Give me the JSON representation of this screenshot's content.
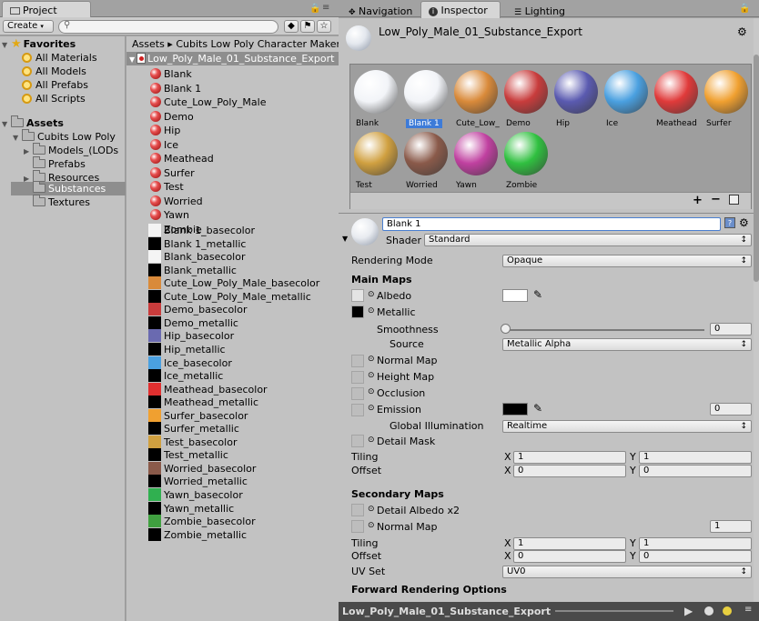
{
  "left_tabs": {
    "project": "Project"
  },
  "right_tabs": {
    "navigation": "Navigation",
    "inspector": "Inspector",
    "lighting": "Lighting"
  },
  "project": {
    "create_label": "Create",
    "breadcrumb": "Assets ▸ Cubits Low Poly Character Maker",
    "favorites": {
      "title": "Favorites",
      "items": [
        "All Materials",
        "All Models",
        "All Prefabs",
        "All Scripts"
      ]
    },
    "assets": {
      "title": "Assets",
      "child": "Cubits Low Poly",
      "subfolders": [
        "Models_(LODs",
        "Prefabs",
        "Resources",
        "Substances",
        "Textures"
      ]
    },
    "substance_name": "Low_Poly_Male_01_Substance_Export",
    "materials": [
      "Blank",
      "Blank 1",
      "Cute_Low_Poly_Male",
      "Demo",
      "Hip",
      "Ice",
      "Meathead",
      "Surfer",
      "Test",
      "Worried",
      "Yawn",
      "Zombie"
    ],
    "textures": [
      {
        "name": "Blank 1_basecolor",
        "color": "#f4f4f4"
      },
      {
        "name": "Blank 1_metallic",
        "color": "#000000"
      },
      {
        "name": "Blank_basecolor",
        "color": "#f4f4f4"
      },
      {
        "name": "Blank_metallic",
        "color": "#000000"
      },
      {
        "name": "Cute_Low_Poly_Male_basecolor",
        "color": "#d98a3a"
      },
      {
        "name": "Cute_Low_Poly_Male_metallic",
        "color": "#000000"
      },
      {
        "name": "Demo_basecolor",
        "color": "#c83c3c"
      },
      {
        "name": "Demo_metallic",
        "color": "#000000"
      },
      {
        "name": "Hip_basecolor",
        "color": "#6a6ab0"
      },
      {
        "name": "Hip_metallic",
        "color": "#000000"
      },
      {
        "name": "Ice_basecolor",
        "color": "#4aa0e0"
      },
      {
        "name": "Ice_metallic",
        "color": "#000000"
      },
      {
        "name": "Meathead_basecolor",
        "color": "#e03030"
      },
      {
        "name": "Meathead_metallic",
        "color": "#000000"
      },
      {
        "name": "Surfer_basecolor",
        "color": "#f0a030"
      },
      {
        "name": "Surfer_metallic",
        "color": "#000000"
      },
      {
        "name": "Test_basecolor",
        "color": "#d0a040"
      },
      {
        "name": "Test_metallic",
        "color": "#000000"
      },
      {
        "name": "Worried_basecolor",
        "color": "#8a5a4a"
      },
      {
        "name": "Worried_metallic",
        "color": "#000000"
      },
      {
        "name": "Yawn_basecolor",
        "color": "#30b050"
      },
      {
        "name": "Yawn_metallic",
        "color": "#000000"
      },
      {
        "name": "Zombie_basecolor",
        "color": "#40a040"
      },
      {
        "name": "Zombie_metallic",
        "color": "#000000"
      }
    ]
  },
  "inspector": {
    "title": "Low_Poly_Male_01_Substance_Export",
    "preview_row1": [
      "Blank",
      "Blank 1",
      "Cute_Low_",
      "Demo",
      "Hip",
      "Ice",
      "Meathead",
      "Surfer"
    ],
    "preview_row2": [
      "Test",
      "Worried",
      "Yawn",
      "Zombie"
    ],
    "preview_colors": [
      "#f2f4f8",
      "#f2f4f8",
      "#d98a3a",
      "#c83c3c",
      "#5a5ab0",
      "#4aa0e0",
      "#e03a3a",
      "#f0a030",
      "#d0a040",
      "#8a5a4a",
      "#c040a0",
      "#30c040"
    ],
    "material_name": "Blank 1",
    "shader_label": "Shader",
    "shader_value": "Standard",
    "rendering_mode_label": "Rendering Mode",
    "rendering_mode_value": "Opaque",
    "main_maps": "Main Maps",
    "albedo": "Albedo",
    "metallic": "Metallic",
    "smoothness": "Smoothness",
    "smoothness_value": "0",
    "source": "Source",
    "source_value": "Metallic Alpha",
    "normal_map": "Normal Map",
    "height_map": "Height Map",
    "occlusion": "Occlusion",
    "emission": "Emission",
    "emission_value": "0",
    "global_illumination": "Global Illumination",
    "gi_value": "Realtime",
    "detail_mask": "Detail Mask",
    "tiling": "Tiling",
    "offset": "Offset",
    "tiling_x": "1",
    "tiling_y": "1",
    "offset_x": "0",
    "offset_y": "0",
    "secondary_maps": "Secondary Maps",
    "detail_albedo": "Detail Albedo x2",
    "normal_map2": "Normal Map",
    "normal_map2_value": "1",
    "tiling2_x": "1",
    "tiling2_y": "1",
    "offset2_x": "0",
    "offset2_y": "0",
    "uv_set": "UV Set",
    "uv_set_value": "UV0",
    "forward_rendering": "Forward Rendering Options"
  },
  "statusbar": {
    "asset": "Low_Poly_Male_01_Substance_Export"
  }
}
